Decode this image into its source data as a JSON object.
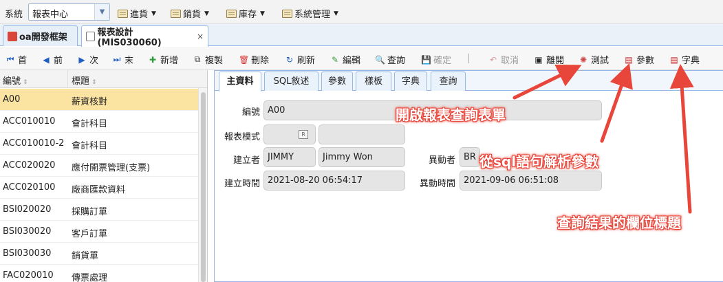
{
  "menubar": {
    "system_label": "系統",
    "system_select_value": "報表中心",
    "menus": [
      "進貨",
      "銷貨",
      "庫存",
      "系統管理"
    ]
  },
  "page_tabs": [
    {
      "label": "oa開發框架"
    },
    {
      "label": "報表設計(MIS030060)",
      "close": "×"
    }
  ],
  "toolbar": {
    "first": "首",
    "prev": "前",
    "next": "次",
    "last": "末",
    "add": "新增",
    "copy": "複製",
    "delete": "刪除",
    "refresh": "刷新",
    "edit": "編輯",
    "query": "查詢",
    "confirm": "確定",
    "sep": "|",
    "cancel": "取消",
    "leave": "離開",
    "test": "測試",
    "params": "參數",
    "dict": "字典"
  },
  "grid": {
    "columns": [
      "編號",
      "標題"
    ],
    "rows": [
      {
        "code": "A00",
        "title": "薪資核對"
      },
      {
        "code": "ACC010010",
        "title": "會計科目"
      },
      {
        "code": "ACC010010-2",
        "title": "會計科目"
      },
      {
        "code": "ACC020020",
        "title": "應付開票管理(支票)"
      },
      {
        "code": "ACC020100",
        "title": "廠商匯款資料"
      },
      {
        "code": "BSI020020",
        "title": "採購訂單"
      },
      {
        "code": "BSI030020",
        "title": "客戶訂單"
      },
      {
        "code": "BSI030030",
        "title": "銷貨單"
      },
      {
        "code": "FAC020010",
        "title": "傳票處理"
      }
    ]
  },
  "detail": {
    "tabs": [
      "主資料",
      "SQL敘述",
      "參數",
      "樣板",
      "字典",
      "查詢"
    ],
    "labels": {
      "code": "編號",
      "mode": "報表模式",
      "creator": "建立者",
      "modifier": "異動者",
      "created_at": "建立時間",
      "modified_at": "異動時間"
    },
    "values": {
      "code": "A00",
      "creator_id": "JIMMY",
      "creator_name": "Jimmy Won",
      "modifier_id": "BR",
      "created_at": "2021-08-20 06:54:17",
      "modified_at": "2021-09-06 06:51:08"
    }
  },
  "annotations": {
    "test": "開啟報表查詢表單",
    "params": "從sql語句解析參數",
    "dict": "查詢結果的欄位標題"
  },
  "colors": {
    "accent_border": "#95b8e7",
    "selected_row": "#fbe3a2",
    "annotation": "#e8463a"
  }
}
